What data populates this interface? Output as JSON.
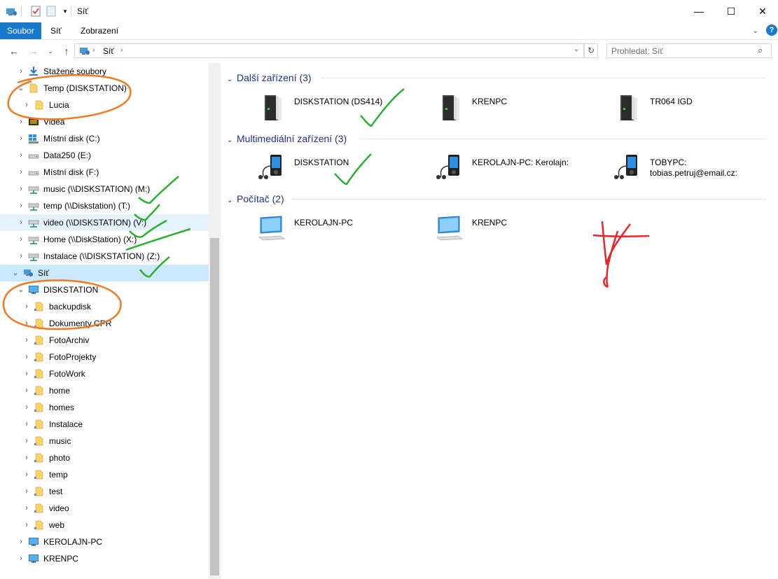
{
  "window": {
    "title": "Síť",
    "quick_access": [
      "computer-network-icon",
      "properties-icon",
      "new-folder-icon",
      "customize-arrow-icon"
    ],
    "controls": {
      "minimize": "—",
      "maximize": "☐",
      "close": "✕"
    }
  },
  "ribbon": {
    "tabs": [
      "Soubor",
      "Síť",
      "Zobrazení"
    ],
    "active_tab": "Soubor",
    "accent": "#1979ca"
  },
  "address": {
    "path": [
      "Síť"
    ],
    "search_placeholder": "Prohledat: Síť"
  },
  "nav": {
    "items": [
      {
        "label": "Stažené soubory",
        "icon": "download-icon",
        "level": 1,
        "expanded": false
      },
      {
        "label": "Temp (DISKSTATION)",
        "icon": "folder-icon",
        "level": 1,
        "expanded": true
      },
      {
        "label": "Lucia",
        "icon": "folder-icon",
        "level": 2,
        "expanded": false
      },
      {
        "label": "Videa",
        "icon": "video-folder-icon",
        "level": 1,
        "expanded": false
      },
      {
        "label": "Místní disk (C:)",
        "icon": "windows-drive-icon",
        "level": 1,
        "expanded": false
      },
      {
        "label": "Data250 (E:)",
        "icon": "drive-icon",
        "level": 1,
        "expanded": false
      },
      {
        "label": "Místní disk (F:)",
        "icon": "drive-icon",
        "level": 1,
        "expanded": false
      },
      {
        "label": "music (\\\\DISKSTATION) (M:)",
        "icon": "network-drive-icon",
        "level": 1,
        "expanded": false
      },
      {
        "label": "temp (\\\\Diskstation) (T:)",
        "icon": "network-drive-icon",
        "level": 1,
        "expanded": false
      },
      {
        "label": "video (\\\\DISKSTATION) (V:)",
        "icon": "network-drive-icon",
        "level": 1,
        "expanded": false,
        "hover": true
      },
      {
        "label": "Home (\\\\DiskStation) (X:)",
        "icon": "network-drive-icon",
        "level": 1,
        "expanded": false
      },
      {
        "label": "Instalace (\\\\DISKSTATION) (Z:)",
        "icon": "network-drive-icon",
        "level": 1,
        "expanded": false
      },
      {
        "label": "Síť",
        "icon": "network-icon",
        "level": 0,
        "expanded": true,
        "selected": true
      },
      {
        "label": "DISKSTATION",
        "icon": "computer-icon",
        "level": 1,
        "expanded": true
      },
      {
        "label": "backupdisk",
        "icon": "share-folder-icon",
        "level": 2,
        "expanded": false
      },
      {
        "label": "Dokumenty CPR",
        "icon": "share-folder-icon",
        "level": 2,
        "expanded": false
      },
      {
        "label": "FotoArchiv",
        "icon": "share-folder-icon",
        "level": 2,
        "expanded": false
      },
      {
        "label": "FotoProjekty",
        "icon": "share-folder-icon",
        "level": 2,
        "expanded": false
      },
      {
        "label": "FotoWork",
        "icon": "share-folder-icon",
        "level": 2,
        "expanded": false
      },
      {
        "label": "home",
        "icon": "share-folder-icon",
        "level": 2,
        "expanded": false
      },
      {
        "label": "homes",
        "icon": "share-folder-icon",
        "level": 2,
        "expanded": false
      },
      {
        "label": "Instalace",
        "icon": "share-folder-icon",
        "level": 2,
        "expanded": false
      },
      {
        "label": "music",
        "icon": "share-folder-icon",
        "level": 2,
        "expanded": false
      },
      {
        "label": "photo",
        "icon": "share-folder-icon",
        "level": 2,
        "expanded": false
      },
      {
        "label": "temp",
        "icon": "share-folder-icon",
        "level": 2,
        "expanded": false
      },
      {
        "label": "test",
        "icon": "share-folder-icon",
        "level": 2,
        "expanded": false
      },
      {
        "label": "video",
        "icon": "share-folder-icon",
        "level": 2,
        "expanded": false
      },
      {
        "label": "web",
        "icon": "share-folder-icon",
        "level": 2,
        "expanded": false
      },
      {
        "label": "KEROLAJN-PC",
        "icon": "computer-icon",
        "level": 1,
        "expanded": false
      },
      {
        "label": "KRENPC",
        "icon": "computer-icon",
        "level": 1,
        "expanded": false
      }
    ]
  },
  "content": {
    "groups": [
      {
        "header": "Další zařízení (3)",
        "items": [
          {
            "label": "DISKSTATION (DS414)",
            "icon": "server-icon"
          },
          {
            "label": "KRENPC",
            "icon": "server-icon"
          },
          {
            "label": "TR064 IGD",
            "icon": "server-icon"
          }
        ]
      },
      {
        "header": "Multimediální zařízení (3)",
        "items": [
          {
            "label": "DISKSTATION",
            "icon": "media-player-icon"
          },
          {
            "label": "KEROLAJN-PC: Kerolajn:",
            "icon": "media-player-icon"
          },
          {
            "label": "TOBYPC:\ntobias.petruj@email.cz:",
            "icon": "media-player-icon"
          }
        ]
      },
      {
        "header": "Počítač (2)",
        "items": [
          {
            "label": "KEROLAJN-PC",
            "icon": "monitor-icon"
          },
          {
            "label": "KRENPC",
            "icon": "monitor-icon"
          }
        ]
      }
    ]
  },
  "annotations": {
    "orange": "#f07a22",
    "green": "#2ab02e",
    "red": "#e8262a"
  }
}
